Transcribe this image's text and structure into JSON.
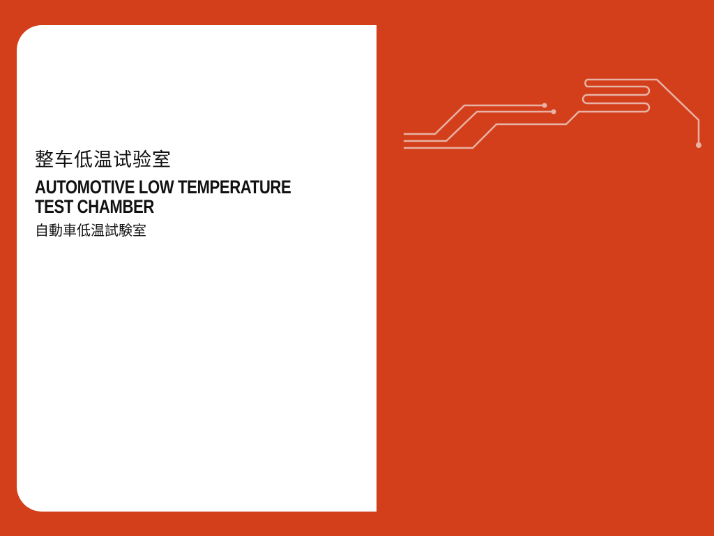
{
  "title": {
    "chinese_simplified": "整车低温试验室",
    "english_line1": "AUTOMOTIVE LOW TEMPERATURE",
    "english_line2": "TEST CHAMBER",
    "chinese_traditional": "自動車低温試験室"
  },
  "colors": {
    "background": "#d33f1b",
    "panel": "#ffffff",
    "text": "#111111",
    "circuit_lines": "#e8b3a5"
  },
  "icons": {
    "decoration": "circuit-lines-icon"
  }
}
